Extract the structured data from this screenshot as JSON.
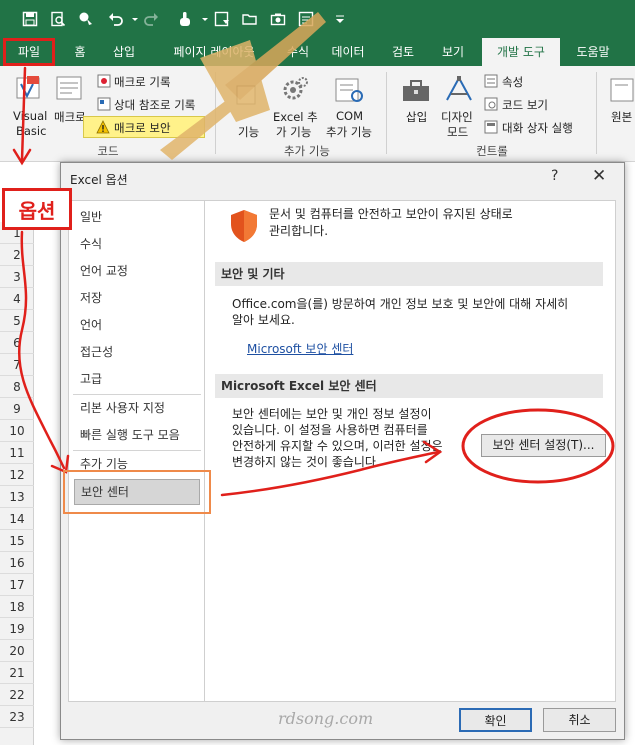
{
  "ribbon_tabs": [
    {
      "label": "파일",
      "active": false,
      "annotated": true
    },
    {
      "label": "홈"
    },
    {
      "label": "삽입"
    },
    {
      "label": "페이지 레이아웃"
    },
    {
      "label": "수식"
    },
    {
      "label": "데이터"
    },
    {
      "label": "검토"
    },
    {
      "label": "보기"
    },
    {
      "label": "개발 도구",
      "active": true
    },
    {
      "label": "도움말"
    }
  ],
  "qat_icons": [
    "save-icon",
    "print-preview-icon",
    "touch-mode-icon",
    "undo-icon",
    "redo-icon",
    "touch-pointer-icon",
    "save-as-icon",
    "open-folder-icon",
    "camera-icon",
    "form-icon",
    "customize-dropdown-icon"
  ],
  "ribbon": {
    "code_group": {
      "visual_basic": [
        "Visual",
        "Basic"
      ],
      "macros": "매크로",
      "record_macro": "매크로 기록",
      "relative_refs": "상대 참조로 기록",
      "macro_security": "매크로 보안",
      "label": "코드"
    },
    "addins_group": {
      "addins": "기능",
      "excel_addins": [
        "Excel 추",
        "가 기능"
      ],
      "com_addins": [
        "COM",
        "추가 기능"
      ],
      "label": "추가 기능"
    },
    "controls_group": {
      "insert": "삽입",
      "design_mode": [
        "디자인",
        "모드"
      ],
      "properties": "속성",
      "view_code": "코드 보기",
      "run_dialog": "대화 상자 실행",
      "label": "컨트롤"
    },
    "xml_group": {
      "source": "원본"
    }
  },
  "row_numbers": [
    "1",
    "2",
    "3",
    "4",
    "5",
    "6",
    "7",
    "8",
    "9",
    "10",
    "11",
    "12",
    "13",
    "14",
    "15",
    "16",
    "17",
    "18",
    "19",
    "20",
    "21",
    "22",
    "23"
  ],
  "dialog": {
    "title": "Excel 옵션",
    "help": "?",
    "close": "✕",
    "nav_items": [
      "일반",
      "수식",
      "언어 교정",
      "저장",
      "언어",
      "접근성",
      "고급",
      "리본 사용자 지정",
      "빠른 실행 도구 모음",
      "추가 기능",
      "보안 센터"
    ],
    "selected_nav": "보안 센터",
    "header_text_1": "문서 및 컴퓨터를 안전하고 보안이 유지된 상태로",
    "header_text_2": "관리합니다.",
    "section1_title": "보안 및 기타",
    "section1_text_1": "Office.com을(를) 방문하여 개인 정보 보호 및 보안에 대해 자세히",
    "section1_text_2": "알아 보세요.",
    "section1_link": "Microsoft 보안 센터",
    "section2_title": "Microsoft Excel 보안 센터",
    "section2_text_1": "보안 센터에는 보안 및 개인 정보 설정이",
    "section2_text_2": "있습니다. 이 설정을 사용하면 컴퓨터를",
    "section2_text_3": "안전하게 유지할 수 있으며, 이러한 설정은",
    "section2_text_4": "변경하지 않는 것이 좋습니다.",
    "trust_center_button": "보안 센터 설정(T)...",
    "ok_button": "확인",
    "cancel_button": "취소"
  },
  "annotations": {
    "options_label": "옵션",
    "color": "#e0201b",
    "watermark": "rdsong.com"
  }
}
